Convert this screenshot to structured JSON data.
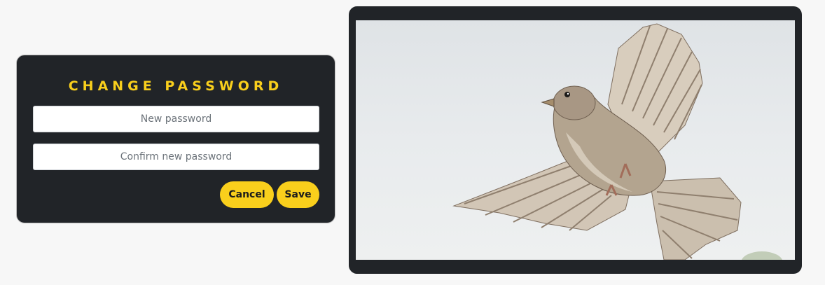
{
  "dialog": {
    "title": "CHANGE PASSWORD",
    "new_password": {
      "value": "",
      "placeholder": "New password"
    },
    "confirm_password": {
      "value": "",
      "placeholder": "Confirm new password"
    },
    "cancel_label": "Cancel",
    "save_label": "Save"
  },
  "image_panel": {
    "subject": "sparrow-in-flight",
    "colors": {
      "frame": "#212428",
      "sky": "#e6e9eb"
    }
  },
  "colors": {
    "accent": "#f9cf1c",
    "card_background": "#212428",
    "page_background": "#f7f7f7"
  }
}
